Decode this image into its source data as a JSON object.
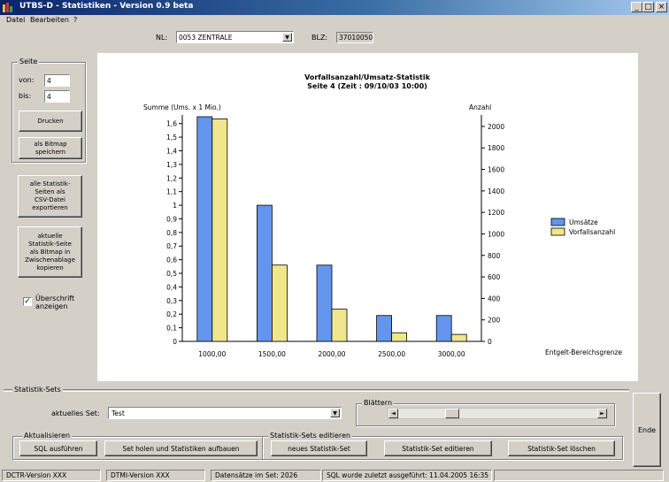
{
  "window": {
    "title": "UTBS-D - Statistiken - Version 0.9 beta"
  },
  "menu": [
    "Datei",
    "Bearbeiten",
    "?"
  ],
  "header": {
    "nl_label": "NL:",
    "nl_value": "0053 ZENTRALE",
    "blz_label": "BLZ:",
    "blz_value": "37010050"
  },
  "sidebar": {
    "group_title": "Seite",
    "von_label": "von:",
    "von_value": "4",
    "bis_label": "bis:",
    "bis_value": "4",
    "print_button": "Drucken",
    "bitmap_button": [
      "als Bitmap",
      "speichern"
    ],
    "csv_button": [
      "alle Statistik-",
      "Seiten als",
      "CSV-Datei",
      "exportieren"
    ],
    "clipboard_button": [
      "aktuelle",
      "Statistik-Seite",
      "als Bitmap in",
      "Zwischenablage",
      "kopieren"
    ],
    "caption_checkbox": {
      "label": [
        "Überschrift",
        "anzeigen"
      ],
      "checked": true
    }
  },
  "chart_data": {
    "type": "bar",
    "title": "Vorfallsanzahl/Umsatz-Statistik",
    "subtitle": "Seite 4 (Zeit : 09/10/03 10:00)",
    "ylabel_left": "Summe (Ums. x 1 Mio.)",
    "ylabel_right": "Anzahl",
    "xlabel": "Entgelt-Bereichsgrenze",
    "categories": [
      "1000,00",
      "1500,00",
      "2000,00",
      "2500,00",
      "3000,00"
    ],
    "series": [
      {
        "name": "Umsätze",
        "axis": "left",
        "color": "#6495ed",
        "values": [
          1.65,
          1.0,
          0.56,
          0.19,
          0.19
        ]
      },
      {
        "name": "Vorfallsanzahl",
        "axis": "right",
        "color": "#f0e68c",
        "values": [
          2070,
          710,
          300,
          80,
          65
        ]
      }
    ],
    "ylim_left": [
      0,
      1.65
    ],
    "yticks_left": [
      "0",
      "0,1",
      "0,2",
      "0,3",
      "0,4",
      "0,5",
      "0,6",
      "0,7",
      "0,8",
      "0,9",
      "1",
      "1,1",
      "1,2",
      "1,3",
      "1,4",
      "1,5",
      "1,6"
    ],
    "ylim_right": [
      0,
      2090
    ],
    "yticks_right": [
      "0",
      "200",
      "400",
      "600",
      "800",
      "1000",
      "1200",
      "1400",
      "1600",
      "1800",
      "2000"
    ],
    "legend": "right",
    "grid": false
  },
  "sets": {
    "group_title": "Statistik-Sets",
    "current_label": "aktuelles Set:",
    "current_value": "Test",
    "blaettern_title": "Blättern",
    "refresh_title": "Aktualisieren",
    "sql_button": "SQL ausführen",
    "fetch_button": "Set holen und Statistiken aufbauen",
    "edit_title": "Statistik-Sets editieren",
    "new_button": "neues Statistik-Set",
    "edit_button": "Statistik-Set editieren",
    "delete_button": "Statistik-Set löschen",
    "end_button": "Ende"
  },
  "status": [
    "DCTR-Version XXX",
    "DTMI-Version XXX",
    "Datensätze im Set: 2026",
    "SQL wurde zuletzt ausgeführt: 11.04.2005 16:35"
  ]
}
